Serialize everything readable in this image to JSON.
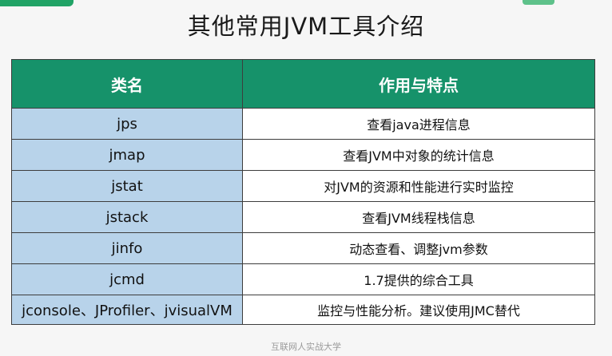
{
  "title": "其他常用JVM工具介绍",
  "table": {
    "headers": [
      "类名",
      "作用与特点"
    ],
    "rows": [
      {
        "name": "jps",
        "desc": "查看java进程信息"
      },
      {
        "name": "jmap",
        "desc": "查看JVM中对象的统计信息"
      },
      {
        "name": "jstat",
        "desc": "对JVM的资源和性能进行实时监控"
      },
      {
        "name": "jstack",
        "desc": "查看JVM线程栈信息"
      },
      {
        "name": "jinfo",
        "desc": "动态查看、调整jvm参数"
      },
      {
        "name": "jcmd",
        "desc": "1.7提供的综合工具"
      },
      {
        "name": "jconsole、JProfiler、jvisualVM",
        "desc": "监控与性能分析。建议使用JMC替代"
      }
    ]
  },
  "watermark": "互联网人实战大学",
  "colors": {
    "header_bg": "#16926a",
    "name_col_bg": "#b8d3ea",
    "desc_col_bg": "#ffffff",
    "accent": "#21a366"
  }
}
